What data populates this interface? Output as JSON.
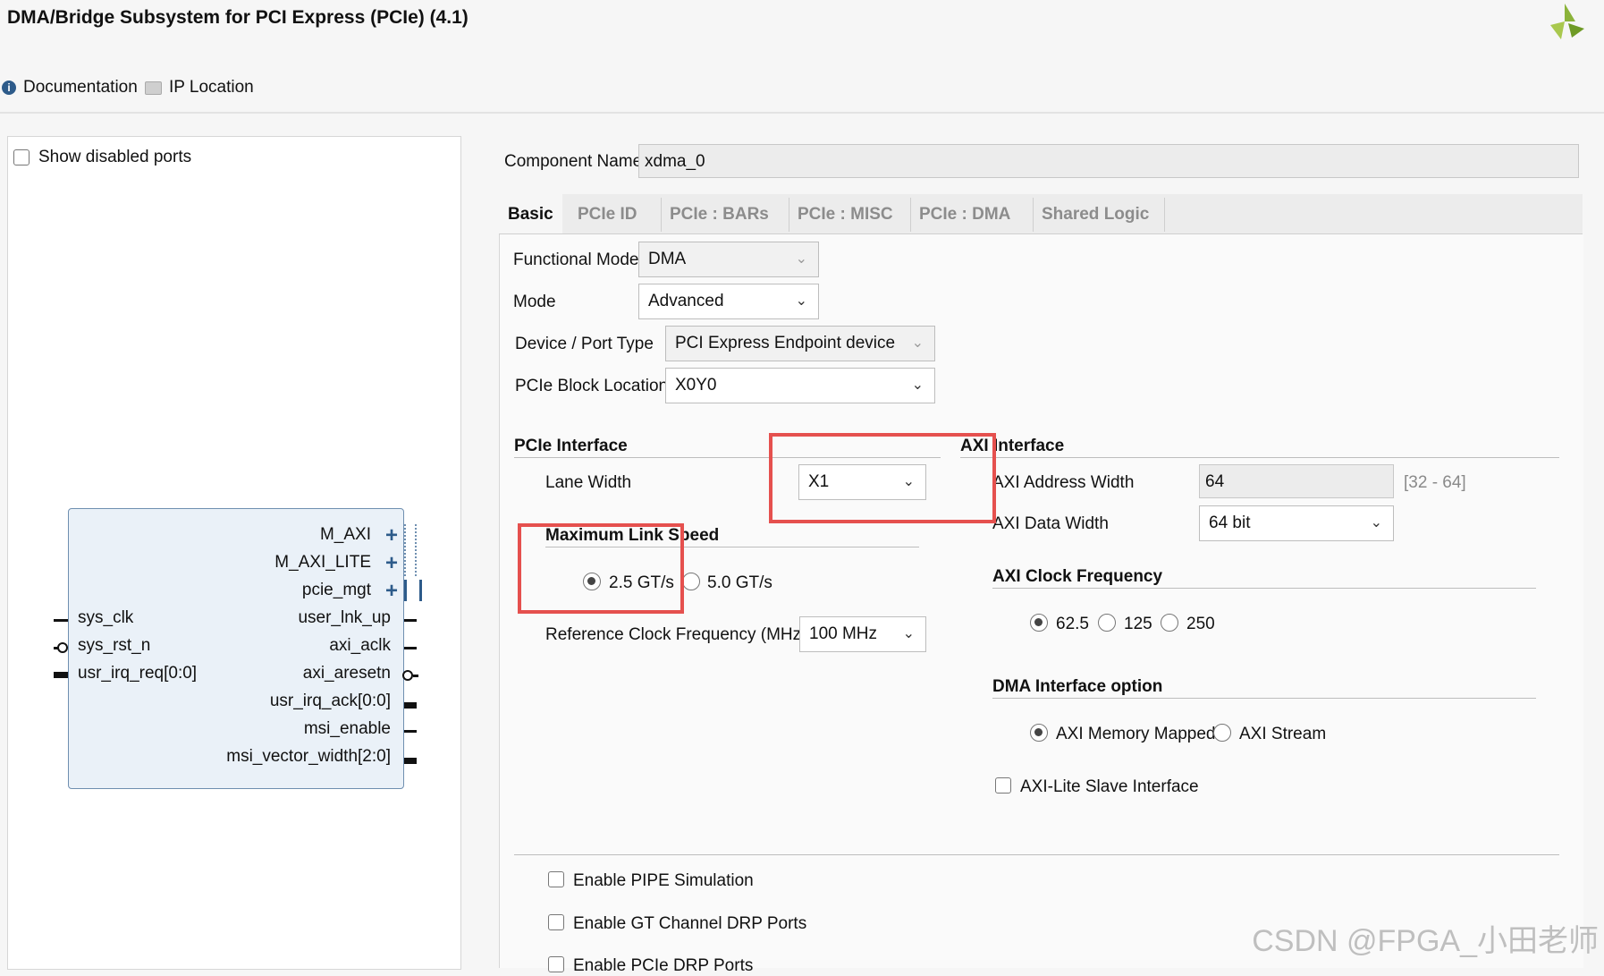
{
  "window": {
    "title": "DMA/Bridge Subsystem for PCI Express (PCIe) (4.1)"
  },
  "toolbar": {
    "documentation": "Documentation",
    "ip_location": "IP Location"
  },
  "left_panel": {
    "show_disabled_ports": "Show disabled ports",
    "ports_right": [
      "M_AXI",
      "M_AXI_LITE",
      "pcie_mgt",
      "user_lnk_up",
      "axi_aclk",
      "axi_aresetn",
      "usr_irq_ack[0:0]",
      "msi_enable",
      "msi_vector_width[2:0]"
    ],
    "ports_left": [
      "sys_clk",
      "sys_rst_n",
      "usr_irq_req[0:0]"
    ]
  },
  "form": {
    "component_name_label": "Component Name",
    "component_name_value": "xdma_0",
    "tabs": [
      "Basic",
      "PCIe ID",
      "PCIe : BARs",
      "PCIe : MISC",
      "PCIe : DMA",
      "Shared Logic"
    ],
    "functional_mode": {
      "label": "Functional Mode",
      "value": "DMA"
    },
    "mode": {
      "label": "Mode",
      "value": "Advanced"
    },
    "device_port_type": {
      "label": "Device / Port Type",
      "value": "PCI Express Endpoint device"
    },
    "pcie_block_location": {
      "label": "PCIe Block Location",
      "value": "X0Y0"
    },
    "pcie_interface": {
      "title": "PCIe Interface",
      "lane_width_label": "Lane Width",
      "lane_width_value": "X1",
      "max_link_speed_title": "Maximum Link Speed",
      "speed_options": [
        "2.5 GT/s",
        "5.0 GT/s"
      ],
      "ref_clk_label": "Reference Clock Frequency (MHz)",
      "ref_clk_value": "100 MHz"
    },
    "axi_interface": {
      "title": "AXI Interface",
      "addr_width_label": "AXI Address Width",
      "addr_width_value": "64",
      "addr_width_range": "[32 - 64]",
      "data_width_label": "AXI Data Width",
      "data_width_value": "64 bit",
      "clock_freq_title": "AXI Clock Frequency",
      "clock_options": [
        "62.5",
        "125",
        "250"
      ],
      "dma_if_title": "DMA Interface option",
      "dma_if_options": [
        "AXI Memory Mapped",
        "AXI Stream"
      ],
      "axi_lite_slave": "AXI-Lite Slave Interface"
    },
    "bottom_checkboxes": [
      "Enable PIPE Simulation",
      "Enable GT Channel DRP Ports",
      "Enable PCIe DRP Ports"
    ]
  },
  "watermark": "CSDN @FPGA_小田老师",
  "colors": {
    "annotation_red": "#e5504e",
    "logo_green": "#8bb33a"
  }
}
